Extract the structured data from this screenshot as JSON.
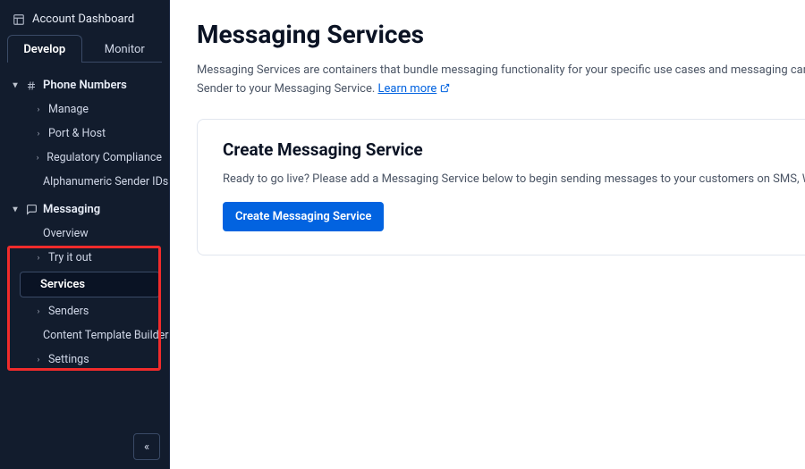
{
  "sidebar": {
    "header": "Account Dashboard",
    "tabs": {
      "develop": "Develop",
      "monitor": "Monitor"
    },
    "phone_numbers": {
      "label": "Phone Numbers",
      "children": {
        "manage": "Manage",
        "port_host": "Port & Host",
        "regulatory": "Regulatory Compliance",
        "alphanumeric": "Alphanumeric Sender IDs"
      }
    },
    "messaging": {
      "label": "Messaging",
      "children": {
        "overview": "Overview",
        "try_it": "Try it out",
        "services": "Services",
        "senders": "Senders",
        "content_template": "Content Template Builder",
        "settings": "Settings"
      }
    }
  },
  "main": {
    "title": "Messaging Services",
    "desc_line1": "Messaging Services are containers that bundle messaging functionality for your specific use cases and messaging campaigns. Select",
    "desc_line2_prefix": "Sender to your Messaging Service. ",
    "learn_more": "Learn more",
    "card": {
      "title": "Create Messaging Service",
      "desc": "Ready to go live? Please add a Messaging Service below to begin sending messages to your customers on SMS, WhatsApp, and",
      "button": "Create Messaging Service"
    }
  }
}
